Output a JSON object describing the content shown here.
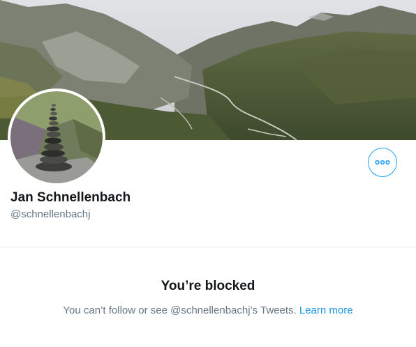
{
  "profile": {
    "display_name": "Jan Schnellenbach",
    "handle": "@schnellenbachj"
  },
  "blocked": {
    "title": "You’re blocked",
    "message": "You can’t follow or see @schnellenbachj’s Tweets. ",
    "learn_more": "Learn more"
  },
  "icons": {
    "more": "more-horizontal-icon"
  },
  "colors": {
    "accent": "#1da1f2",
    "link": "#1b95e0",
    "primary_text": "#14171a",
    "secondary_text": "#657786",
    "divider": "#e6ecf0"
  }
}
